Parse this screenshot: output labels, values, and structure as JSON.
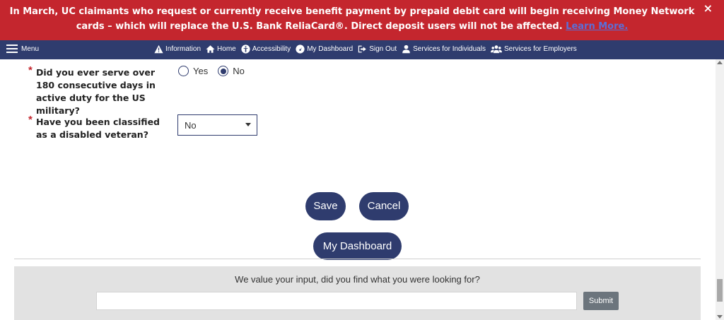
{
  "alert": {
    "text": "In March, UC claimants who request or currently receive benefit payment by prepaid debit card will begin receiving Money Network cards – which will replace the U.S. Bank ReliaCard®. Direct deposit users will not be affected.",
    "link": "Learn More.",
    "close": "×"
  },
  "nav": {
    "menu": "Menu",
    "links": [
      "Information",
      "Home",
      "Accessibility",
      "My Dashboard",
      "Sign Out",
      "Services for Individuals",
      "Services for Employers"
    ]
  },
  "form": {
    "required_mark": "*",
    "q1": {
      "label": "Did you ever serve over 180 consecutive days in active duty for the US military?",
      "options": [
        "Yes",
        "No"
      ],
      "selected": "No"
    },
    "q2": {
      "label": "Have you been classified as a disabled veteran?",
      "value": "No"
    }
  },
  "buttons": {
    "save": "Save",
    "cancel": "Cancel",
    "dashboard": "My Dashboard"
  },
  "feedback": {
    "prompt": "We value your input, did you find what you were looking for?",
    "input_value": "",
    "submit": "Submit"
  },
  "colors": {
    "banner": "#c4262e",
    "navbar": "#2f3c6e",
    "primary": "#2f3c6e",
    "submit": "#6c757d"
  }
}
